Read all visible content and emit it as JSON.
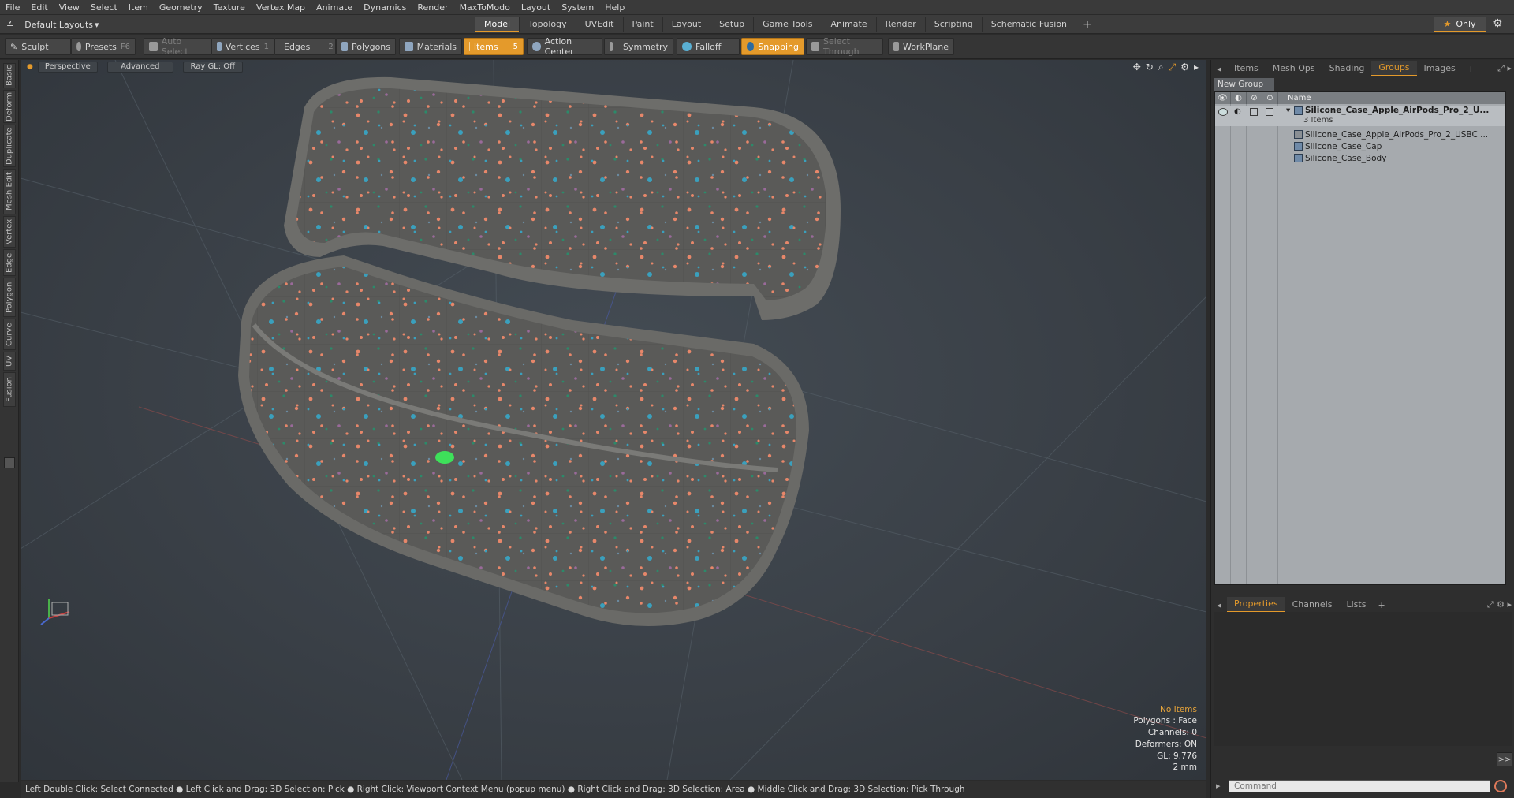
{
  "menu": [
    "File",
    "Edit",
    "View",
    "Select",
    "Item",
    "Geometry",
    "Texture",
    "Vertex Map",
    "Animate",
    "Dynamics",
    "Render",
    "MaxToModo",
    "Layout",
    "System",
    "Help"
  ],
  "layout": {
    "dropdown": "Default Layouts",
    "tabs": [
      "Model",
      "Topology",
      "UVEdit",
      "Paint",
      "Layout",
      "Setup",
      "Game Tools",
      "Animate",
      "Render",
      "Scripting",
      "Schematic Fusion"
    ],
    "active_tab": "Model",
    "only_label": "Only"
  },
  "toolbar": {
    "sculpt": "Sculpt",
    "presets": "Presets",
    "presets_key": "F6",
    "auto_select": "Auto Select",
    "vertices": "Vertices",
    "vertices_key": "1",
    "edges": "Edges",
    "edges_key": "2",
    "polygons": "Polygons",
    "materials": "Materials",
    "items": "Items",
    "items_key": "5",
    "action_center": "Action Center",
    "symmetry": "Symmetry",
    "falloff": "Falloff",
    "snapping": "Snapping",
    "select_through": "Select Through",
    "workplane": "WorkPlane"
  },
  "left_tabs": [
    "Basic",
    "Deform",
    "Duplicate",
    "Mesh Edit",
    "Vertex",
    "Edge",
    "Polygon",
    "Curve",
    "UV",
    "Fusion"
  ],
  "viewport": {
    "view": "Perspective",
    "shading": "Advanced",
    "raygl": "Ray GL: Off",
    "hud": {
      "no_items": "No Items",
      "polygons": "Polygons : Face",
      "channels": "Channels: 0",
      "deformers": "Deformers: ON",
      "gl": "GL: 9,776",
      "unit": "2 mm"
    }
  },
  "status_text": "Left Double Click: Select Connected ● Left Click and Drag: 3D Selection: Pick ● Right Click: Viewport Context Menu (popup menu) ● Right Click and Drag: 3D Selection: Area ● Middle Click and Drag: 3D Selection: Pick Through",
  "right_panel": {
    "tabs": [
      "Items",
      "Mesh Ops",
      "Shading",
      "Groups",
      "Images"
    ],
    "active_tab": "Groups",
    "new_group": "New Group",
    "name_header": "Name",
    "group_name": "Silicone_Case_Apple_AirPods_Pro_2_U...",
    "group_count": "3 Items",
    "children": [
      "Silicone_Case_Apple_AirPods_Pro_2_USBC ...",
      "Silicone_Case_Cap",
      "Silicone_Case_Body"
    ],
    "bottom_tabs": [
      "Properties",
      "Channels",
      "Lists"
    ],
    "bottom_active": "Properties",
    "command_placeholder": "Command",
    "expand_label": ">>"
  },
  "colors": {
    "accent": "#e49a2b",
    "viewport_bg": "#3a4047",
    "tree_bg": "#a6aaae"
  }
}
